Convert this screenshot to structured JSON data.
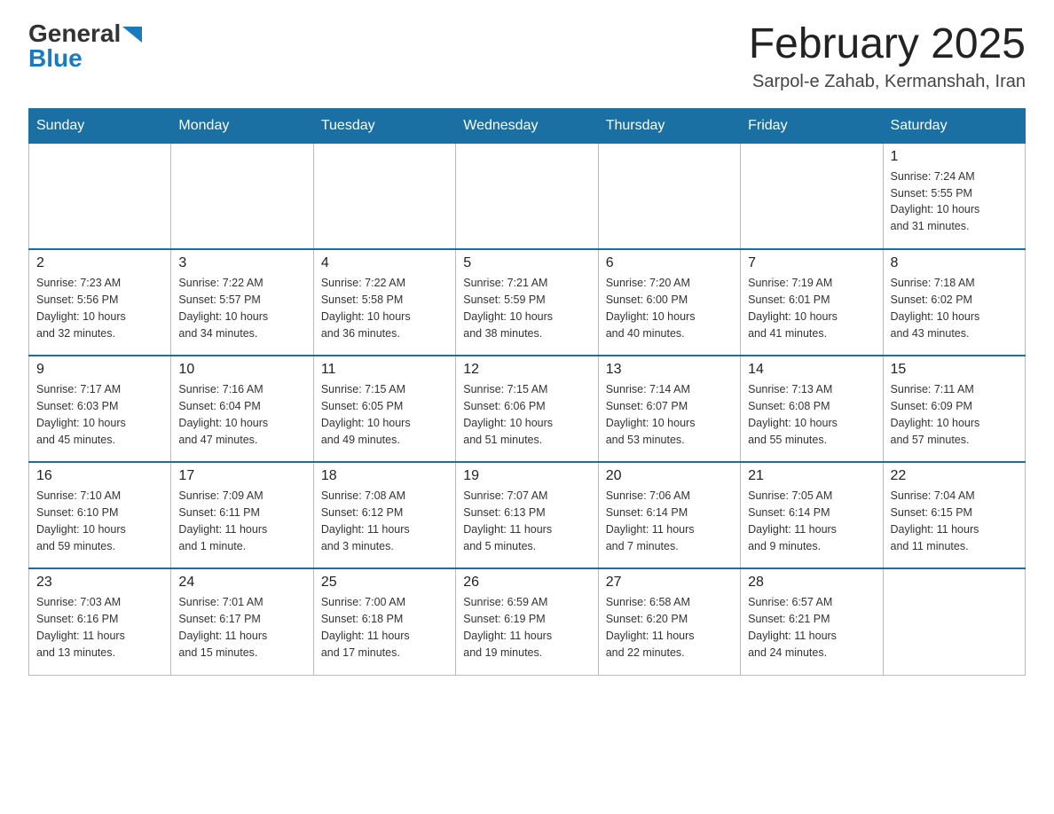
{
  "header": {
    "logo_general": "General",
    "logo_blue": "Blue",
    "month_title": "February 2025",
    "location": "Sarpol-e Zahab, Kermanshah, Iran"
  },
  "weekdays": [
    "Sunday",
    "Monday",
    "Tuesday",
    "Wednesday",
    "Thursday",
    "Friday",
    "Saturday"
  ],
  "weeks": [
    [
      {
        "day": "",
        "info": ""
      },
      {
        "day": "",
        "info": ""
      },
      {
        "day": "",
        "info": ""
      },
      {
        "day": "",
        "info": ""
      },
      {
        "day": "",
        "info": ""
      },
      {
        "day": "",
        "info": ""
      },
      {
        "day": "1",
        "info": "Sunrise: 7:24 AM\nSunset: 5:55 PM\nDaylight: 10 hours\nand 31 minutes."
      }
    ],
    [
      {
        "day": "2",
        "info": "Sunrise: 7:23 AM\nSunset: 5:56 PM\nDaylight: 10 hours\nand 32 minutes."
      },
      {
        "day": "3",
        "info": "Sunrise: 7:22 AM\nSunset: 5:57 PM\nDaylight: 10 hours\nand 34 minutes."
      },
      {
        "day": "4",
        "info": "Sunrise: 7:22 AM\nSunset: 5:58 PM\nDaylight: 10 hours\nand 36 minutes."
      },
      {
        "day": "5",
        "info": "Sunrise: 7:21 AM\nSunset: 5:59 PM\nDaylight: 10 hours\nand 38 minutes."
      },
      {
        "day": "6",
        "info": "Sunrise: 7:20 AM\nSunset: 6:00 PM\nDaylight: 10 hours\nand 40 minutes."
      },
      {
        "day": "7",
        "info": "Sunrise: 7:19 AM\nSunset: 6:01 PM\nDaylight: 10 hours\nand 41 minutes."
      },
      {
        "day": "8",
        "info": "Sunrise: 7:18 AM\nSunset: 6:02 PM\nDaylight: 10 hours\nand 43 minutes."
      }
    ],
    [
      {
        "day": "9",
        "info": "Sunrise: 7:17 AM\nSunset: 6:03 PM\nDaylight: 10 hours\nand 45 minutes."
      },
      {
        "day": "10",
        "info": "Sunrise: 7:16 AM\nSunset: 6:04 PM\nDaylight: 10 hours\nand 47 minutes."
      },
      {
        "day": "11",
        "info": "Sunrise: 7:15 AM\nSunset: 6:05 PM\nDaylight: 10 hours\nand 49 minutes."
      },
      {
        "day": "12",
        "info": "Sunrise: 7:15 AM\nSunset: 6:06 PM\nDaylight: 10 hours\nand 51 minutes."
      },
      {
        "day": "13",
        "info": "Sunrise: 7:14 AM\nSunset: 6:07 PM\nDaylight: 10 hours\nand 53 minutes."
      },
      {
        "day": "14",
        "info": "Sunrise: 7:13 AM\nSunset: 6:08 PM\nDaylight: 10 hours\nand 55 minutes."
      },
      {
        "day": "15",
        "info": "Sunrise: 7:11 AM\nSunset: 6:09 PM\nDaylight: 10 hours\nand 57 minutes."
      }
    ],
    [
      {
        "day": "16",
        "info": "Sunrise: 7:10 AM\nSunset: 6:10 PM\nDaylight: 10 hours\nand 59 minutes."
      },
      {
        "day": "17",
        "info": "Sunrise: 7:09 AM\nSunset: 6:11 PM\nDaylight: 11 hours\nand 1 minute."
      },
      {
        "day": "18",
        "info": "Sunrise: 7:08 AM\nSunset: 6:12 PM\nDaylight: 11 hours\nand 3 minutes."
      },
      {
        "day": "19",
        "info": "Sunrise: 7:07 AM\nSunset: 6:13 PM\nDaylight: 11 hours\nand 5 minutes."
      },
      {
        "day": "20",
        "info": "Sunrise: 7:06 AM\nSunset: 6:14 PM\nDaylight: 11 hours\nand 7 minutes."
      },
      {
        "day": "21",
        "info": "Sunrise: 7:05 AM\nSunset: 6:14 PM\nDaylight: 11 hours\nand 9 minutes."
      },
      {
        "day": "22",
        "info": "Sunrise: 7:04 AM\nSunset: 6:15 PM\nDaylight: 11 hours\nand 11 minutes."
      }
    ],
    [
      {
        "day": "23",
        "info": "Sunrise: 7:03 AM\nSunset: 6:16 PM\nDaylight: 11 hours\nand 13 minutes."
      },
      {
        "day": "24",
        "info": "Sunrise: 7:01 AM\nSunset: 6:17 PM\nDaylight: 11 hours\nand 15 minutes."
      },
      {
        "day": "25",
        "info": "Sunrise: 7:00 AM\nSunset: 6:18 PM\nDaylight: 11 hours\nand 17 minutes."
      },
      {
        "day": "26",
        "info": "Sunrise: 6:59 AM\nSunset: 6:19 PM\nDaylight: 11 hours\nand 19 minutes."
      },
      {
        "day": "27",
        "info": "Sunrise: 6:58 AM\nSunset: 6:20 PM\nDaylight: 11 hours\nand 22 minutes."
      },
      {
        "day": "28",
        "info": "Sunrise: 6:57 AM\nSunset: 6:21 PM\nDaylight: 11 hours\nand 24 minutes."
      },
      {
        "day": "",
        "info": ""
      }
    ]
  ]
}
